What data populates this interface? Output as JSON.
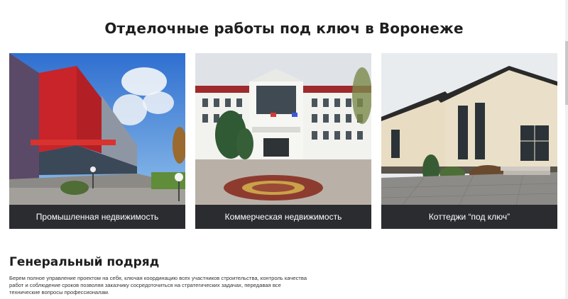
{
  "page": {
    "title": "Отделочные работы под ключ в Воронеже"
  },
  "cards": [
    {
      "caption": "Промышленная недвижимость",
      "photo": "industrial-building-photo"
    },
    {
      "caption": "Коммерческая недвижимость",
      "photo": "commercial-hotel-photo"
    },
    {
      "caption": "Коттеджи “под ключ”",
      "photo": "cottage-photo"
    }
  ],
  "section": {
    "heading": "Генеральный подряд",
    "text": "Берем полное управление проектом на себя, ключая координацию всех участников строительства, контроль качества работ и соблюдение сроков позволяя заказчику сосредоточиться на стратегических задачах, передавая все технические вопросы профессионалам."
  },
  "colors": {
    "caption_bg": "#2b2c30",
    "caption_text": "#ffffff",
    "heading": "#1e1e1e"
  }
}
